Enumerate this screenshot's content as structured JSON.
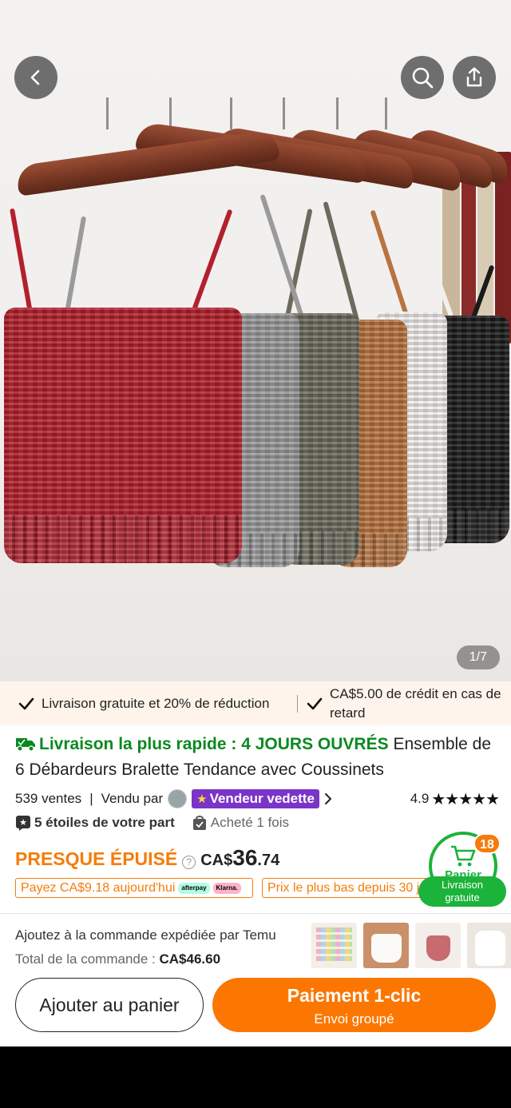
{
  "image": {
    "counter": "1/7",
    "tops": [
      "red",
      "grey",
      "olive",
      "tan",
      "white",
      "black"
    ],
    "colors": {
      "red": "#b3202c",
      "grey": "#9a9a9a",
      "olive": "#6b6a5c",
      "tan": "#b8733f",
      "white": "#f2f0ee",
      "black": "#1a1a1a"
    }
  },
  "nav": {
    "back_icon": "chevron-left-icon",
    "search_icon": "search-icon",
    "share_icon": "share-icon"
  },
  "promo": {
    "left_text": "Livraison gratuite et 20% de réduction",
    "right_text": "CA$5.00 de crédit en cas de retard"
  },
  "product": {
    "fast_delivery": "Livraison la plus rapide : 4 JOURS OUVRÉS",
    "title": "Ensemble de 6 Débardeurs Bralette Tendance avec Coussinets",
    "sales": "539 ventes",
    "sold_by": "Vendu par",
    "seller_badge": "Vendeur vedette",
    "rating": "4.9",
    "stars": 5,
    "review_line": "5 étoiles de votre part",
    "purchased": "Acheté 1 fois",
    "stock_status": "PRESQUE ÉPUISÉ",
    "currency": "CA$",
    "price_int": "36",
    "price_dec": ".74",
    "pay_today": "Payez CA$9.18 aujourd'hui",
    "lowest_price": "Prix le plus bas depuis 30 jours"
  },
  "cart": {
    "count": "18",
    "label": "Panier",
    "free_line1": "Livraison",
    "free_line2": "gratuite"
  },
  "addon": {
    "line": "Ajoutez à la commande expédiée par Temu",
    "total_label": "Total de la commande :",
    "total_value": "CA$46.60"
  },
  "buttons": {
    "add_to_cart": "Ajouter au panier",
    "pay_main": "Paiement 1-clic",
    "pay_sub": "Envoi groupé"
  },
  "accent": {
    "orange": "#fb7701",
    "green": "#0a8a1f",
    "purple": "#7a34c8"
  }
}
